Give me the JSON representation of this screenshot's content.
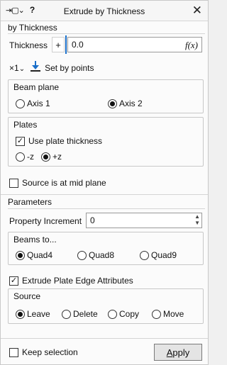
{
  "window": {
    "title": "Extrude by Thickness",
    "help_label": "?",
    "close_glyph": "✕",
    "pin_glyph": "⇥▢⌄"
  },
  "by_thickness": {
    "section_label": "by Thickness",
    "thickness_label": "Thickness",
    "plus_label": "+",
    "thickness_value": "0.0",
    "fx_label": "f(x)",
    "multiplier_label": "×1",
    "set_by_points_label": "Set by points"
  },
  "beam_plane": {
    "title": "Beam plane",
    "options": [
      "Axis 1",
      "Axis 2"
    ],
    "selected": "Axis 2"
  },
  "plates": {
    "title": "Plates",
    "use_plate_thickness_label": "Use plate thickness",
    "use_plate_thickness_checked": true,
    "direction_options": [
      "-z",
      "+z"
    ],
    "direction_selected": "+z"
  },
  "source_mid_plane": {
    "label": "Source is at mid plane",
    "checked": false
  },
  "parameters": {
    "section_label": "Parameters",
    "property_increment_label": "Property Increment",
    "property_increment_value": "0",
    "beams_to": {
      "title": "Beams to...",
      "options": [
        "Quad4",
        "Quad8",
        "Quad9"
      ],
      "selected": "Quad4"
    },
    "extrude_edge_label": "Extrude Plate Edge Attributes",
    "extrude_edge_checked": true,
    "source": {
      "title": "Source",
      "options": [
        "Leave",
        "Delete",
        "Copy",
        "Move"
      ],
      "selected": "Leave"
    }
  },
  "footer": {
    "keep_selection_label": "Keep selection",
    "keep_selection_checked": false,
    "apply_first": "A",
    "apply_rest": "pply"
  },
  "colors": {
    "accent": "#1a6fc9",
    "panel_bg": "#fbfbfb"
  }
}
